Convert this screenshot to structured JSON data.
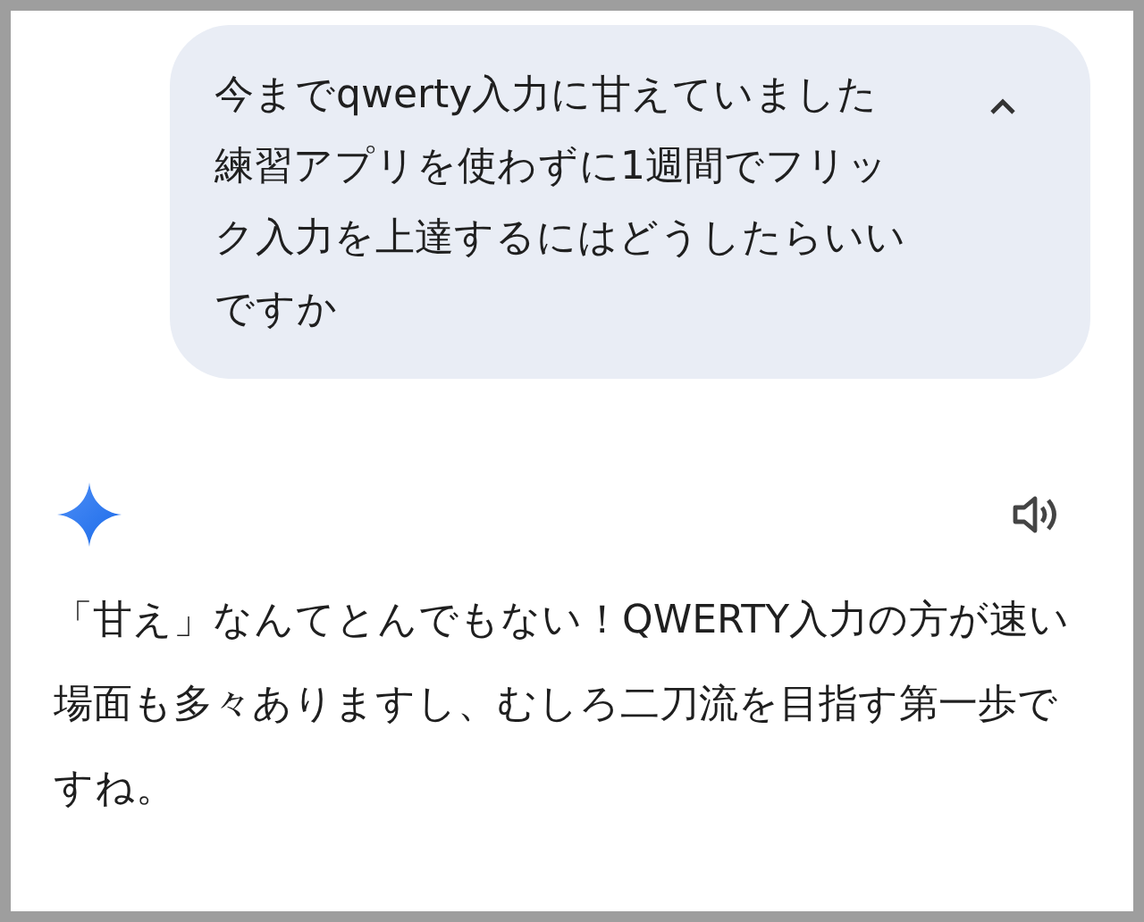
{
  "prompt": {
    "paragraphs": [
      "今までqwerty入力に甘えていました",
      "練習アプリを使わずに1週間でフリック入力を上達するにはどうしたらいいですか"
    ],
    "expanded": true
  },
  "response": {
    "text": "「甘え」なんてとんでもない！QWERTY入力の方が速い場面も多々ありますし、むしろ二刀流を目指す第一歩ですね。"
  }
}
